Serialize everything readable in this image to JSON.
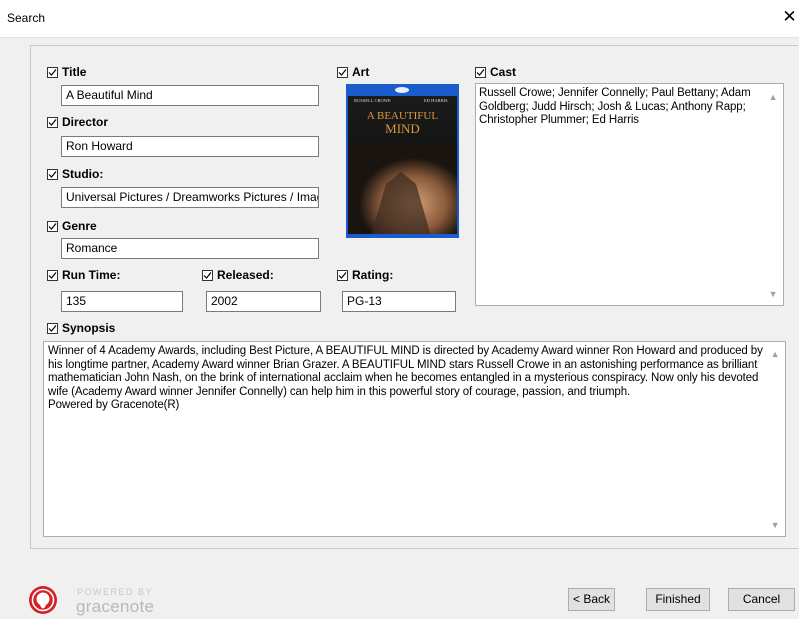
{
  "window": {
    "title": "Search",
    "close_glyph": "✕"
  },
  "fields": {
    "title": {
      "label": "Title",
      "value": "A Beautiful Mind",
      "checked": true
    },
    "director": {
      "label": "Director",
      "value": "Ron Howard",
      "checked": true
    },
    "studio": {
      "label": "Studio:",
      "value": "Universal Pictures / Dreamworks Pictures / Imagir",
      "checked": true
    },
    "genre": {
      "label": "Genre",
      "value": "Romance",
      "checked": true
    },
    "run_time": {
      "label": "Run Time:",
      "value": "135",
      "checked": true
    },
    "released": {
      "label": "Released:",
      "value": "2002",
      "checked": true
    },
    "rating": {
      "label": "Rating:",
      "value": "PG-13",
      "checked": true
    },
    "art": {
      "label": "Art",
      "checked": true
    },
    "cast": {
      "label": "Cast",
      "checked": true,
      "value": "Russell Crowe; Jennifer Connelly; Paul Bettany; Adam Goldberg; Judd Hirsch; Josh & Lucas; Anthony Rapp; Christopher Plummer; Ed Harris"
    },
    "synopsis": {
      "label": "Synopsis",
      "checked": true,
      "value": "Winner of 4 Academy Awards, including Best Picture, A BEAUTIFUL MIND is directed by Academy Award winner Ron Howard and produced by his longtime partner, Academy Award winner Brian Grazer. A BEAUTIFUL MIND stars Russell Crowe in an astonishing performance as brilliant mathematician John Nash, on the brink of international acclaim when he becomes entangled in a mysterious conspiracy. Now only his devoted wife (Academy Award winner Jennifer Connelly) can help him in this powerful story of courage, passion, and triumph.",
      "footer": "Powered by Gracenote(R)"
    }
  },
  "cover": {
    "actor_left": "RUSSELL CROWE",
    "actor_right": "ED HARRIS",
    "title_line1": "A BEAUTIFUL",
    "title_line2": "MIND",
    "brand_color": "#1a5ccc"
  },
  "logo": {
    "powered_by": "POWERED BY",
    "name": "gracenote",
    "color": "#d42027"
  },
  "buttons": {
    "back": "< Back",
    "finished": "Finished",
    "cancel": "Cancel"
  },
  "icons": {
    "checkbox": "checkmark-icon",
    "scroll_up": "▲",
    "scroll_down": "▼"
  }
}
